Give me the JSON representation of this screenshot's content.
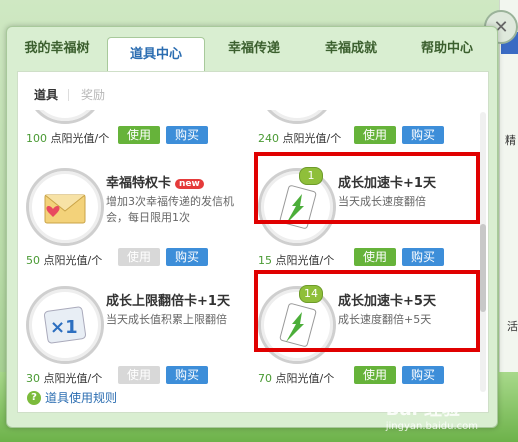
{
  "tabs": [
    "我的幸福树",
    "道具中心",
    "幸福传递",
    "幸福成就",
    "帮助中心"
  ],
  "active_tab": "道具中心",
  "subtabs": {
    "tools": "道具",
    "rewards": "奖励"
  },
  "items_top": [
    {
      "price_num": "100",
      "price_unit": "点阳光值/个",
      "use": "使用",
      "buy": "购买"
    },
    {
      "price_num": "240",
      "price_unit": "点阳光值/个",
      "use": "使用",
      "buy": "购买"
    }
  ],
  "items": [
    {
      "name": "幸福特权卡",
      "badge": "new",
      "desc": "增加3次幸福传递的发信机会，每日限用1次",
      "price_num": "50",
      "price_unit": "点阳光值/个",
      "use": "使用",
      "buy": "购买",
      "use_disabled": true,
      "icon": "envelope-heart-icon"
    },
    {
      "name": "成长加速卡+1天",
      "count": "1",
      "desc": "当天成长速度翻倍",
      "price_num": "15",
      "price_unit": "点阳光值/个",
      "use": "使用",
      "buy": "购买",
      "use_disabled": false,
      "icon": "growth-card-1-icon"
    },
    {
      "name": "成长上限翻倍卡+1天",
      "desc": "当天成长值积累上限翻倍",
      "price_num": "30",
      "price_unit": "点阳光值/个",
      "use": "使用",
      "buy": "购买",
      "use_disabled": true,
      "icon": "x-one-card-icon"
    },
    {
      "name": "成长加速卡+5天",
      "count": "14",
      "desc": "成长速度翻倍+5天",
      "price_num": "70",
      "price_unit": "点阳光值/个",
      "use": "使用",
      "buy": "购买",
      "use_disabled": false,
      "icon": "growth-card-5-icon"
    }
  ],
  "help_link": "道具使用规则",
  "side": {
    "label1": "精",
    "label2": "活"
  },
  "watermark": {
    "main": "Bai 经验",
    "sub": "jingyan.baidu.com"
  },
  "colors": {
    "use_green": "#66b33a",
    "buy_blue": "#3d8ed9",
    "highlight_red": "#e00000",
    "price_green": "#4a9a34"
  }
}
